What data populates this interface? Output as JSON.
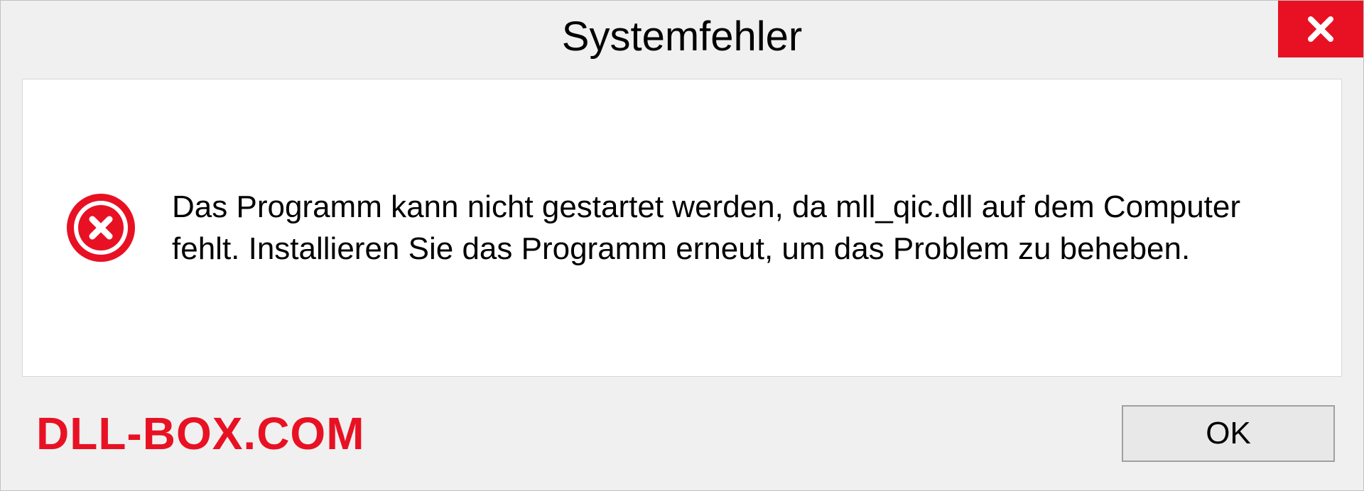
{
  "dialog": {
    "title": "Systemfehler",
    "message": "Das Programm kann nicht gestartet werden, da mll_qic.dll auf dem Computer fehlt. Installieren Sie das Programm erneut, um das Problem zu beheben.",
    "ok_label": "OK"
  },
  "watermark": "DLL-BOX.COM"
}
